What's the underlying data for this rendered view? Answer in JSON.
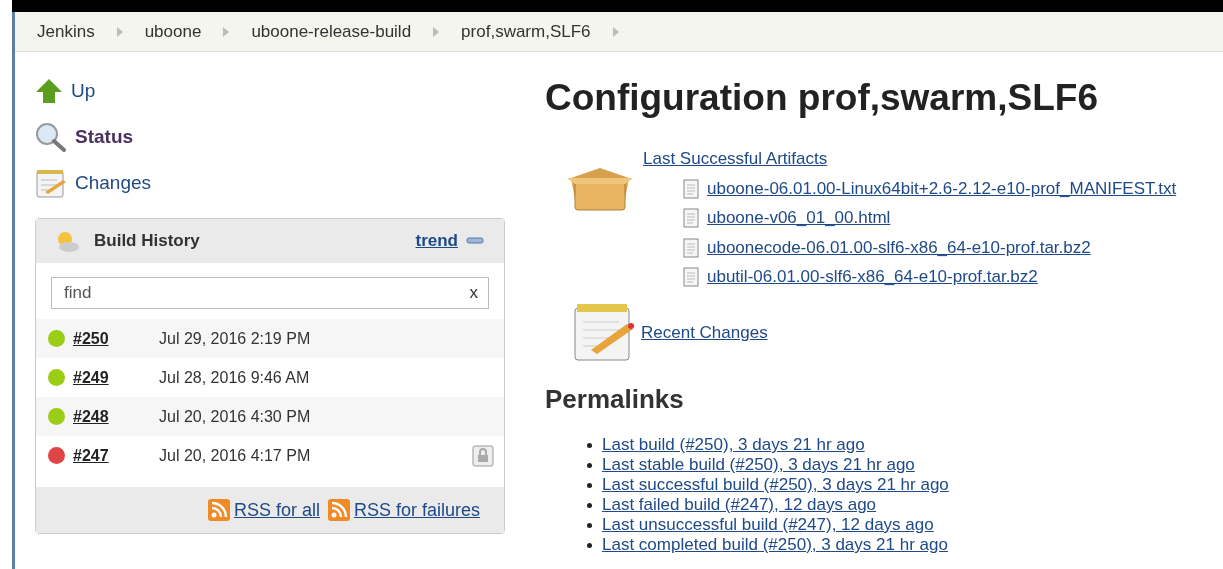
{
  "breadcrumbs": [
    "Jenkins",
    "uboone",
    "uboone-release-build",
    "prof,swarm,SLF6"
  ],
  "sidebar": {
    "items": [
      {
        "label": "Up",
        "selected": false
      },
      {
        "label": "Status",
        "selected": true
      },
      {
        "label": "Changes",
        "selected": false
      }
    ]
  },
  "build_history": {
    "title": "Build History",
    "trend": "trend",
    "search": {
      "placeholder": "find",
      "clear": "x"
    },
    "builds": [
      {
        "number": "#250",
        "date": "Jul 29, 2016 2:19 PM",
        "color": "#9acd16",
        "locked": false
      },
      {
        "number": "#249",
        "date": "Jul 28, 2016 9:46 AM",
        "color": "#9acd16",
        "locked": false
      },
      {
        "number": "#248",
        "date": "Jul 20, 2016 4:30 PM",
        "color": "#9acd16",
        "locked": false
      },
      {
        "number": "#247",
        "date": "Jul 20, 2016 4:17 PM",
        "color": "#e04545",
        "locked": true
      }
    ],
    "feeds": [
      "RSS for all",
      "RSS for failures"
    ]
  },
  "main": {
    "title": "Configuration prof,swarm,SLF6",
    "artifacts": {
      "label": "Last Successful Artifacts",
      "files": [
        "uboone-06.01.00-Linux64bit+2.6-2.12-e10-prof_MANIFEST.txt",
        "uboone-v06_01_00.html",
        "uboonecode-06.01.00-slf6-x86_64-e10-prof.tar.bz2",
        "ubutil-06.01.00-slf6-x86_64-e10-prof.tar.bz2"
      ]
    },
    "recent_changes": "Recent Changes",
    "permalinks_title": "Permalinks",
    "permalinks": [
      "Last build (#250), 3 days 21 hr ago",
      "Last stable build (#250), 3 days 21 hr ago",
      "Last successful build (#250), 3 days 21 hr ago",
      "Last failed build (#247), 12 days ago",
      "Last unsuccessful build (#247), 12 days ago",
      "Last completed build (#250), 3 days 21 hr ago"
    ]
  }
}
